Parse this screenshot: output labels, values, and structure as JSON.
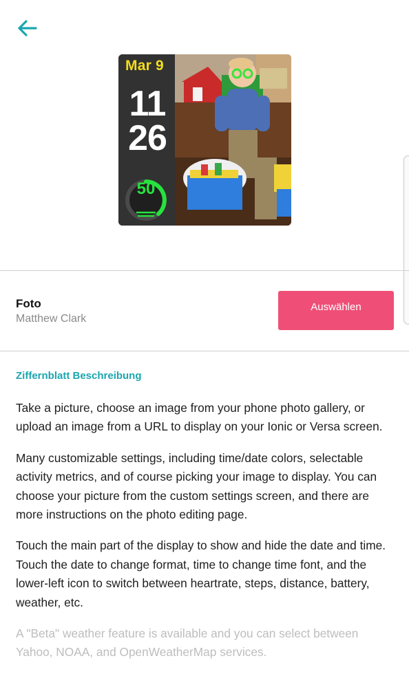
{
  "header": {
    "back_icon": "arrow-left-icon",
    "accent_color": "#1aa6b0"
  },
  "preview": {
    "date": "Mar 9",
    "hour": "11",
    "minute": "26",
    "metric_value": "50",
    "date_color": "#f3dc1f",
    "metric_color": "#27e23e"
  },
  "app": {
    "title": "Foto",
    "author": "Matthew Clark",
    "select_label": "Auswählen",
    "select_color": "#ef4f77"
  },
  "description": {
    "heading": "Ziffernblatt Beschreibung",
    "paragraphs": [
      "Take a picture, choose an image from your phone photo gallery, or upload an image from a URL to display on your Ionic or Versa screen.",
      "Many customizable settings, including time/date colors, selectable activity metrics, and of course picking your image to display. You can choose your picture from the custom settings screen, and there are more instructions on the photo editing page.",
      "Touch the main part of the display to show and hide the date and time. Touch the date to change format, time to change time font, and the lower-left icon to switch between heartrate, steps, distance, battery, weather, etc.",
      "A \"Beta\" weather feature is available and you can select between Yahoo, NOAA, and OpenWeatherMap services."
    ]
  }
}
